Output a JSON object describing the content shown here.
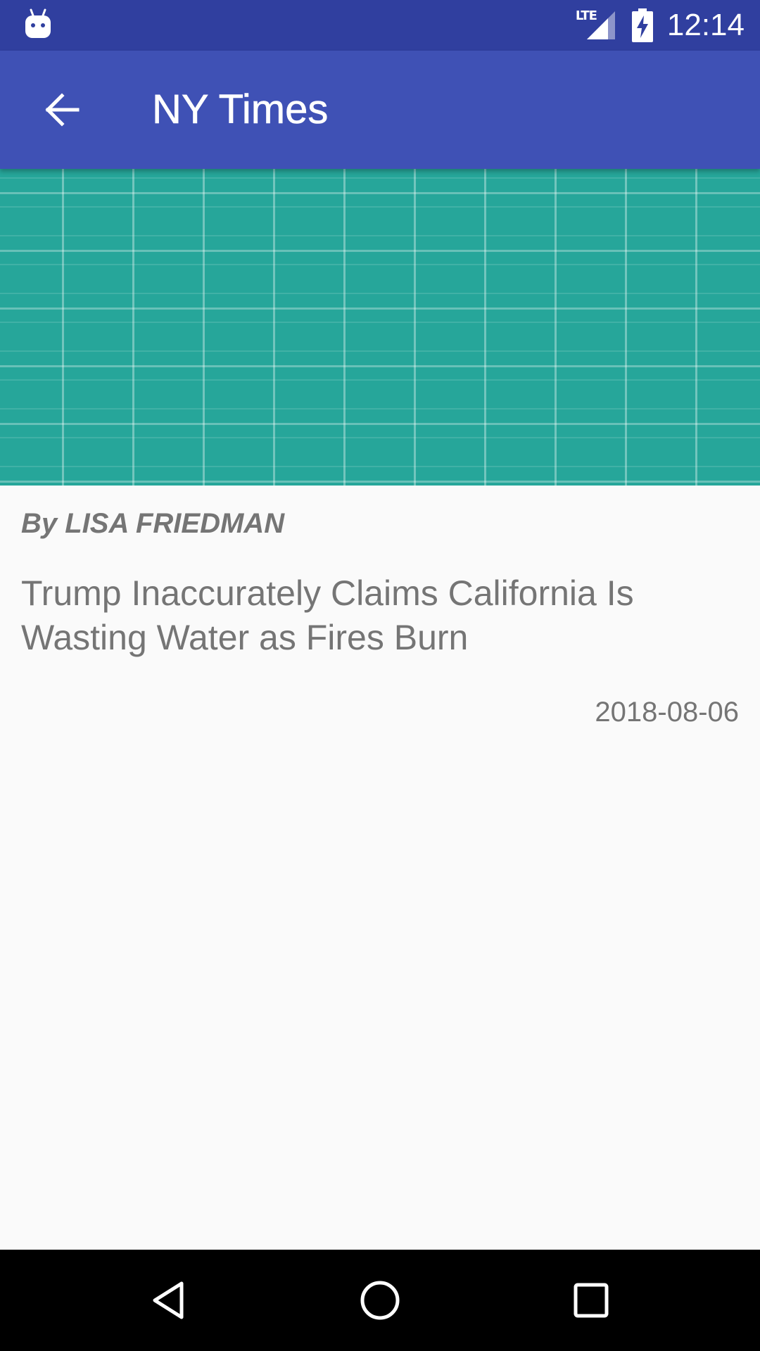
{
  "status_bar": {
    "time": "12:14",
    "network_label": "LTE",
    "icons": [
      "android-notification-icon",
      "lte-signal-icon",
      "battery-charging-icon"
    ]
  },
  "app_bar": {
    "title": "NY Times",
    "back_icon": "arrow-back-icon"
  },
  "article": {
    "byline": "By LISA FRIEDMAN",
    "headline": "Trump Inaccurately Claims California Is Wasting Water as Fires Burn",
    "date": "2018-08-06",
    "image": "teal-grid-placeholder"
  },
  "nav_bar": {
    "icons": [
      "nav-back-icon",
      "nav-home-icon",
      "nav-recents-icon"
    ]
  },
  "colors": {
    "status_bar": "#303F9F",
    "app_bar": "#3F51B5",
    "image_background": "#26A69A",
    "body_text": "#757575",
    "background": "#FAFAFA"
  }
}
